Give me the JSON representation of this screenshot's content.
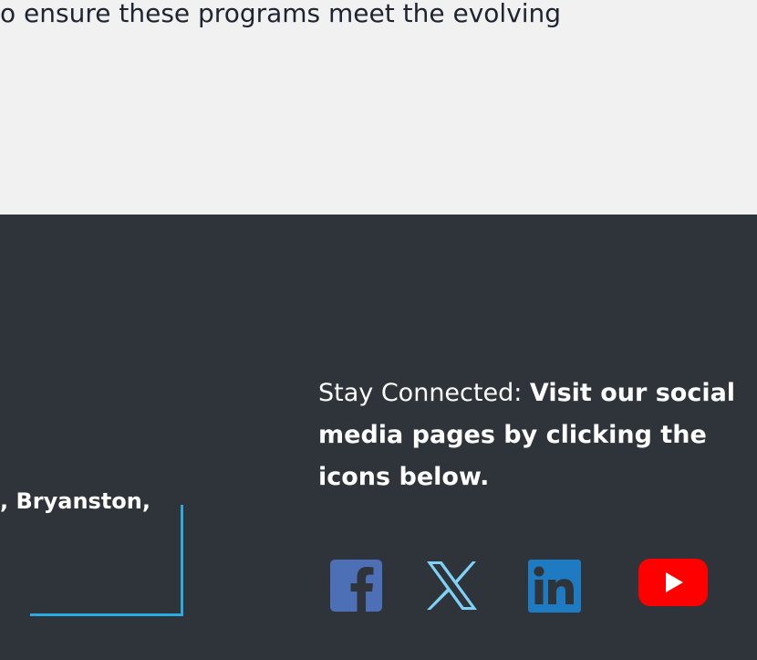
{
  "intro": {
    "text": "o ensure these programs meet the evolving"
  },
  "footer": {
    "address_line": ", Bryanston,",
    "stay_connected": {
      "lead": "Stay Connected: ",
      "message": "Visit our social media pages by clicking the icons below."
    },
    "social_links": [
      {
        "name": "Facebook",
        "icon": "facebook-icon",
        "color": "#4c6fb5"
      },
      {
        "name": "X",
        "icon": "x-icon",
        "color": "#7fd1f5"
      },
      {
        "name": "LinkedIn",
        "icon": "linkedin-icon",
        "color": "#1f7bc1"
      },
      {
        "name": "YouTube",
        "icon": "youtube-icon",
        "color": "#ff0000"
      }
    ],
    "colors": {
      "background": "#2f333a",
      "accent": "#29abe2",
      "text": "#ffffff"
    }
  },
  "page": {
    "top_background": "#f1f1f1"
  }
}
